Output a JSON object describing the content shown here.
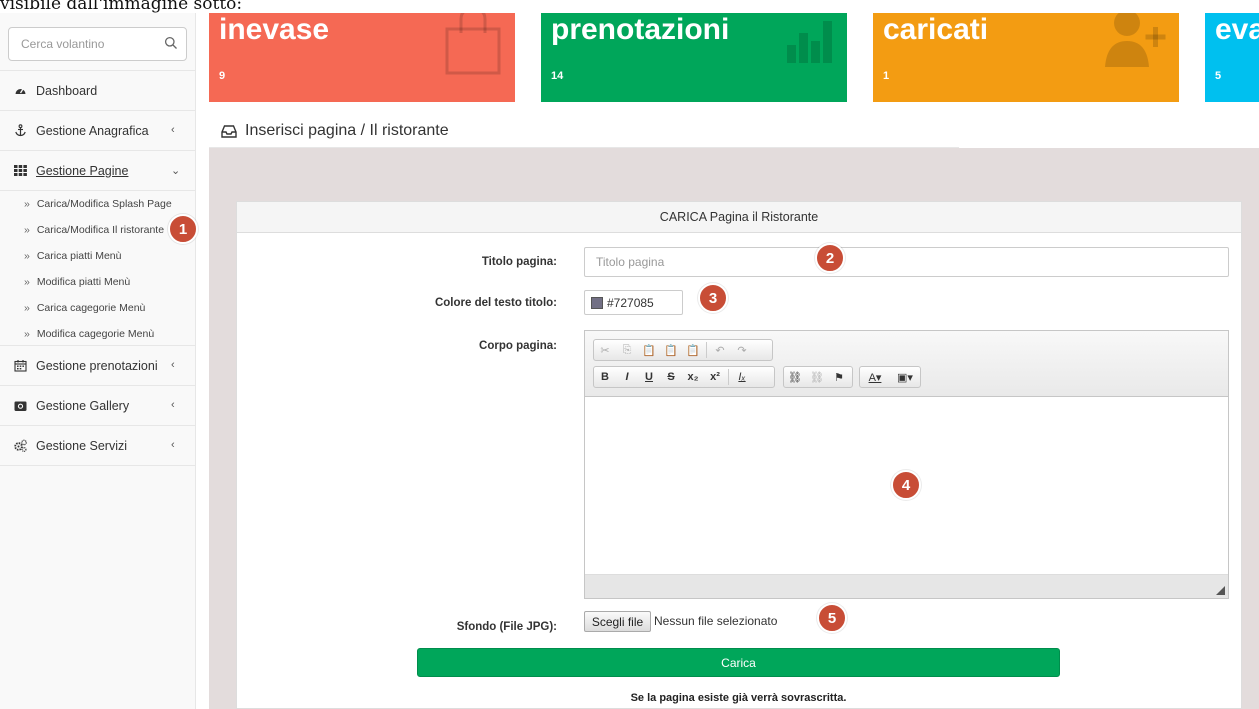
{
  "caption": "visibile dall'immagine sotto:",
  "sidebar": {
    "search_placeholder": "Cerca volantino",
    "items": [
      {
        "label": "Dashboard"
      },
      {
        "label": "Gestione Anagrafica"
      },
      {
        "label": "Gestione Pagine"
      },
      {
        "label": "Gestione prenotazioni"
      },
      {
        "label": "Gestione Gallery"
      },
      {
        "label": "Gestione Servizi"
      }
    ],
    "subitems": [
      {
        "label": "Carica/Modifica Splash Page"
      },
      {
        "label": "Carica/Modifica Il ristorante"
      },
      {
        "label": "Carica piatti Menù"
      },
      {
        "label": "Modifica piatti Menù"
      },
      {
        "label": "Carica cagegorie Menù"
      },
      {
        "label": "Modifica cagegorie Menù"
      }
    ]
  },
  "stats": [
    {
      "title": "inevase",
      "value": "9",
      "color": "#f56954",
      "icon": "shopping-bag-icon"
    },
    {
      "title": "prenotazioni",
      "value": "14",
      "color": "#00a65a",
      "icon": "bar-chart-icon"
    },
    {
      "title": "caricati",
      "value": "1",
      "color": "#f39c12",
      "icon": "user-plus-icon"
    },
    {
      "title": "evase",
      "value": "5",
      "color": "#00c0ef",
      "icon": ""
    }
  ],
  "header": {
    "title": "Inserisci pagina / Il ristorante"
  },
  "panel": {
    "title": "CARICA Pagina il Ristorante",
    "titolo_label": "Titolo pagina:",
    "titolo_placeholder": "Titolo pagina",
    "colore_label": "Colore del testo titolo:",
    "colore_value": "#727085",
    "corpo_label": "Corpo pagina:",
    "sfondo_label": "Sfondo (File JPG):",
    "file_button": "Scegli file",
    "file_status": "Nessun file selezionato",
    "submit_label": "Carica",
    "note": "Se la pagina esiste già verrà sovrascritta."
  },
  "markers": [
    "1",
    "2",
    "3",
    "4",
    "5"
  ]
}
